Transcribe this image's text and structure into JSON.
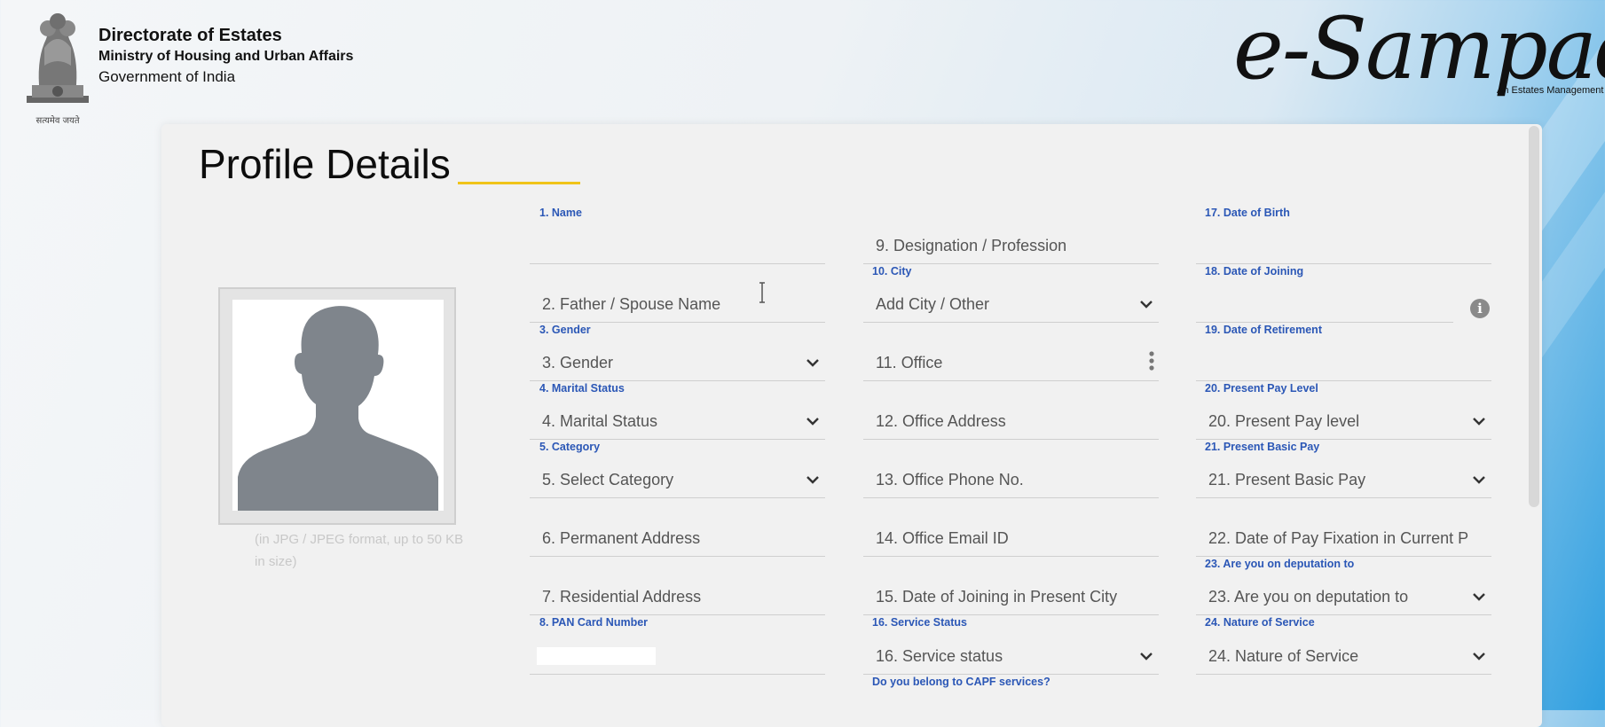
{
  "header": {
    "org_line1": "Directorate of Estates",
    "org_line2": "Ministry of Housing and Urban Affairs",
    "org_line3": "Government of India",
    "emblem_caption": "सत्यमेव जयते",
    "brand": "e-Sampad",
    "brand_tagline": "An Estates Management"
  },
  "page": {
    "title": "Profile Details",
    "photo_note": "(in JPG / JPEG format, up to 50 KB in size)"
  },
  "col1": {
    "f1": {
      "label": "1. Name",
      "value": ""
    },
    "f2": {
      "placeholder": "2. Father / Spouse Name"
    },
    "f3": {
      "label": "3. Gender",
      "value": "3. Gender"
    },
    "f4": {
      "label": "4. Marital Status",
      "value": "4. Marital Status"
    },
    "f5": {
      "label": "5. Category",
      "value": "5. Select Category"
    },
    "f6": {
      "placeholder": "6. Permanent Address"
    },
    "f7": {
      "placeholder": "7. Residential Address"
    },
    "f8": {
      "label": "8. PAN Card Number"
    }
  },
  "col2": {
    "f9": {
      "placeholder": "9. Designation / Profession"
    },
    "f10": {
      "label": "10. City",
      "value": "Add City / Other"
    },
    "f11": {
      "placeholder": "11. Office"
    },
    "f12": {
      "placeholder": "12. Office Address"
    },
    "f13": {
      "placeholder": "13. Office Phone No."
    },
    "f14": {
      "placeholder": "14. Office Email ID"
    },
    "f15": {
      "placeholder": "15. Date of Joining in Present City"
    },
    "f16": {
      "label": "16. Service Status",
      "value": "16. Service status"
    },
    "capf_label": "Do you belong to CAPF services?"
  },
  "col3": {
    "f17": {
      "label": "17. Date of Birth"
    },
    "f18": {
      "label": "18. Date of Joining"
    },
    "f19": {
      "label": "19. Date of Retirement"
    },
    "f20": {
      "label": "20. Present Pay Level",
      "value": "20. Present Pay level"
    },
    "f21": {
      "label": "21. Present Basic Pay",
      "value": "21. Present Basic Pay"
    },
    "f22": {
      "placeholder": "22. Date of Pay Fixation in Current P"
    },
    "f23": {
      "label": "23. Are you on deputation to",
      "value": "23. Are you on deputation to"
    },
    "f24": {
      "label": "24. Nature of Service",
      "value": "24. Nature of Service"
    }
  },
  "icons": {
    "chevron": "chevron-down-icon",
    "dots": "more-vertical-icon",
    "info": "info-icon"
  },
  "colors": {
    "label_blue": "#2b57b6",
    "underline_yellow": "#f0c419",
    "brand_bg_blue": "#2f9fe0"
  }
}
